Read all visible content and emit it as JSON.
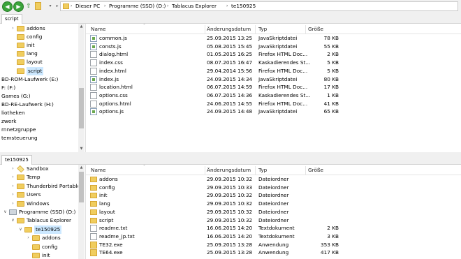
{
  "toolbar": {
    "back_icon": "back-arrow-icon",
    "forward_icon": "forward-arrow-icon",
    "up_icon": "up-arrow-icon",
    "address_crumbs": [
      "Dieser PC",
      "Programme (SSD) (D:)",
      "Tablacus Explorer",
      "te150925"
    ]
  },
  "top": {
    "tab_label": "script",
    "tree": [
      {
        "label": "addons",
        "kind": "folder",
        "twisty": ">"
      },
      {
        "label": "config",
        "kind": "folder",
        "twisty": ""
      },
      {
        "label": "init",
        "kind": "folder",
        "twisty": ""
      },
      {
        "label": "lang",
        "kind": "folder",
        "twisty": ""
      },
      {
        "label": "layout",
        "kind": "folder",
        "twisty": ""
      },
      {
        "label": "script",
        "kind": "folder",
        "twisty": "",
        "selected": true
      },
      {
        "label": "BD-ROM-Laufwerk (E:)",
        "kind": "text"
      },
      {
        "label": "F: (F:)",
        "kind": "text"
      },
      {
        "label": "Games (G:)",
        "kind": "text"
      },
      {
        "label": "BD-RE-Laufwerk (H:)",
        "kind": "text"
      },
      {
        "label": "liotheken",
        "kind": "text"
      },
      {
        "label": "zwerk",
        "kind": "text"
      },
      {
        "label": "rnnetzgruppe",
        "kind": "text"
      },
      {
        "label": "temsteuerung",
        "kind": "text"
      }
    ],
    "columns": [
      "Name",
      "Änderungsdatum",
      "Typ",
      "Größe"
    ],
    "files": [
      {
        "name": "common.js",
        "date": "25.09.2015 13:25",
        "type": "JavaSkriptdatei",
        "size": "78 KB",
        "icon": "js"
      },
      {
        "name": "consts.js",
        "date": "05.08.2015 15:45",
        "type": "JavaSkriptdatei",
        "size": "55 KB",
        "icon": "js"
      },
      {
        "name": "dialog.html",
        "date": "01.05.2015 16:25",
        "type": "Firefox HTML Doc...",
        "size": "2 KB",
        "icon": "html"
      },
      {
        "name": "index.css",
        "date": "08.07.2015 16:47",
        "type": "Kaskadierendes St...",
        "size": "5 KB",
        "icon": "css"
      },
      {
        "name": "index.html",
        "date": "29.04.2014 15:56",
        "type": "Firefox HTML Doc...",
        "size": "5 KB",
        "icon": "html"
      },
      {
        "name": "index.js",
        "date": "24.09.2015 14:34",
        "type": "JavaSkriptdatei",
        "size": "80 KB",
        "icon": "js"
      },
      {
        "name": "location.html",
        "date": "06.07.2015 14:59",
        "type": "Firefox HTML Doc...",
        "size": "17 KB",
        "icon": "html"
      },
      {
        "name": "options.css",
        "date": "06.07.2015 14:36",
        "type": "Kaskadierendes St...",
        "size": "1 KB",
        "icon": "css"
      },
      {
        "name": "options.html",
        "date": "24.06.2015 14:55",
        "type": "Firefox HTML Doc...",
        "size": "41 KB",
        "icon": "html"
      },
      {
        "name": "options.js",
        "date": "24.09.2015 14:48",
        "type": "JavaSkriptdatei",
        "size": "65 KB",
        "icon": "js"
      }
    ]
  },
  "bottom": {
    "tab_label": "te150925",
    "tree": [
      {
        "label": "Sandbox",
        "kind": "sandbox",
        "twisty": ">",
        "indent": 1
      },
      {
        "label": "Temp",
        "kind": "folder",
        "twisty": ">",
        "indent": 1
      },
      {
        "label": "Thunderbird Portable",
        "kind": "folder",
        "twisty": ">",
        "indent": 1
      },
      {
        "label": "Users",
        "kind": "folder",
        "twisty": ">",
        "indent": 1
      },
      {
        "label": "Windows",
        "kind": "folder",
        "twisty": ">",
        "indent": 1
      },
      {
        "label": "Programme (SSD) (D:)",
        "kind": "drive",
        "twisty": "v",
        "indent": 0
      },
      {
        "label": "Tablacus Explorer",
        "kind": "folder",
        "twisty": "v",
        "indent": 1
      },
      {
        "label": "te150925",
        "kind": "folder",
        "twisty": "v",
        "indent": 2,
        "selected": true
      },
      {
        "label": "addons",
        "kind": "folder",
        "twisty": ">",
        "indent": 3
      },
      {
        "label": "config",
        "kind": "folder",
        "twisty": "",
        "indent": 3
      },
      {
        "label": "init",
        "kind": "folder",
        "twisty": "",
        "indent": 3
      }
    ],
    "columns": [
      "Name",
      "Änderungsdatum",
      "Typ",
      "Größe"
    ],
    "files": [
      {
        "name": "addons",
        "date": "29.09.2015 10:32",
        "type": "Dateiordner",
        "size": "",
        "icon": "folder"
      },
      {
        "name": "config",
        "date": "29.09.2015 10:33",
        "type": "Dateiordner",
        "size": "",
        "icon": "folder"
      },
      {
        "name": "init",
        "date": "29.09.2015 10:32",
        "type": "Dateiordner",
        "size": "",
        "icon": "folder"
      },
      {
        "name": "lang",
        "date": "29.09.2015 10:32",
        "type": "Dateiordner",
        "size": "",
        "icon": "folder"
      },
      {
        "name": "layout",
        "date": "29.09.2015 10:32",
        "type": "Dateiordner",
        "size": "",
        "icon": "folder"
      },
      {
        "name": "script",
        "date": "29.09.2015 10:32",
        "type": "Dateiordner",
        "size": "",
        "icon": "folder"
      },
      {
        "name": "readme.txt",
        "date": "16.06.2015 14:20",
        "type": "Textdokument",
        "size": "2 KB",
        "icon": "txt"
      },
      {
        "name": "readme_jp.txt",
        "date": "16.06.2015 14:20",
        "type": "Textdokument",
        "size": "3 KB",
        "icon": "txt"
      },
      {
        "name": "TE32.exe",
        "date": "25.09.2015 13:28",
        "type": "Anwendung",
        "size": "353 KB",
        "icon": "exe"
      },
      {
        "name": "TE64.exe",
        "date": "25.09.2015 13:28",
        "type": "Anwendung",
        "size": "417 KB",
        "icon": "exe"
      }
    ]
  }
}
